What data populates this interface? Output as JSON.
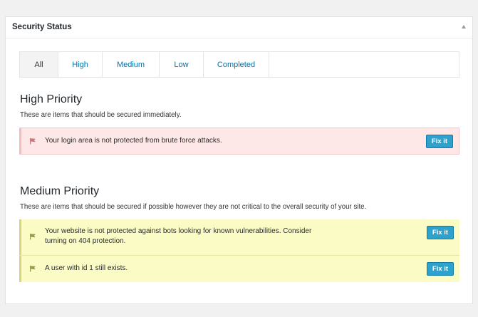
{
  "panel": {
    "title": "Security Status"
  },
  "tabs": [
    {
      "label": "All",
      "active": true
    },
    {
      "label": "High",
      "active": false
    },
    {
      "label": "Medium",
      "active": false
    },
    {
      "label": "Low",
      "active": false
    },
    {
      "label": "Completed",
      "active": false
    }
  ],
  "high": {
    "title": "High Priority",
    "description": "These are items that should be secured immediately.",
    "items": [
      {
        "text": "Your login area is not protected from brute force attacks.",
        "button": "Fix it"
      }
    ]
  },
  "medium": {
    "title": "Medium Priority",
    "description": "These are items that should be secured if possible however they are not critical to the overall security of your site.",
    "items": [
      {
        "text_line1": "Your website is not protected against bots looking for known vulnerabilities. Consider",
        "text_line2": "turning on 404 protection.",
        "button": "Fix it"
      },
      {
        "text": "A user with id 1 still exists.",
        "button": "Fix it"
      }
    ]
  },
  "colors": {
    "accent": "#2ea2cc",
    "high_bg": "#fde7e7",
    "medium_bg": "#fbfcc5",
    "link": "#0073aa"
  }
}
